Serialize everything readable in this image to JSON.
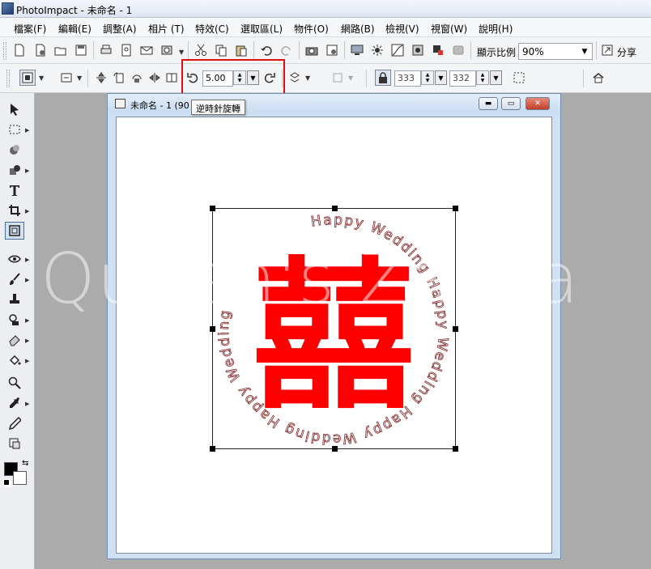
{
  "app": {
    "title": "PhotoImpact - 未命名 - 1"
  },
  "menu": [
    "檔案(F)",
    "編輯(E)",
    "調整(A)",
    "相片 (T)",
    "特效(C)",
    "選取區(L)",
    "物件(O)",
    "網路(B)",
    "檢視(V)",
    "視窗(W)",
    "說明(H)"
  ],
  "toolbar1": {
    "zoom_label": "顯示比例",
    "zoom_value": "90%",
    "share_label": "分享"
  },
  "toolbar2": {
    "rotate_value": "5.00",
    "width_value": "333",
    "height_value": "332"
  },
  "tooltip": {
    "text": "逆時針旋轉"
  },
  "document": {
    "title": "未命名 - 1 (90"
  },
  "artwork": {
    "ring_text": "Happy Wedding",
    "center_glyph": "囍",
    "glyph_color": "#ff0000",
    "ring_color": "#7a1f1f"
  },
  "watermark": {
    "text": "Queen's Zakka"
  },
  "highlight_color": "#e01010"
}
